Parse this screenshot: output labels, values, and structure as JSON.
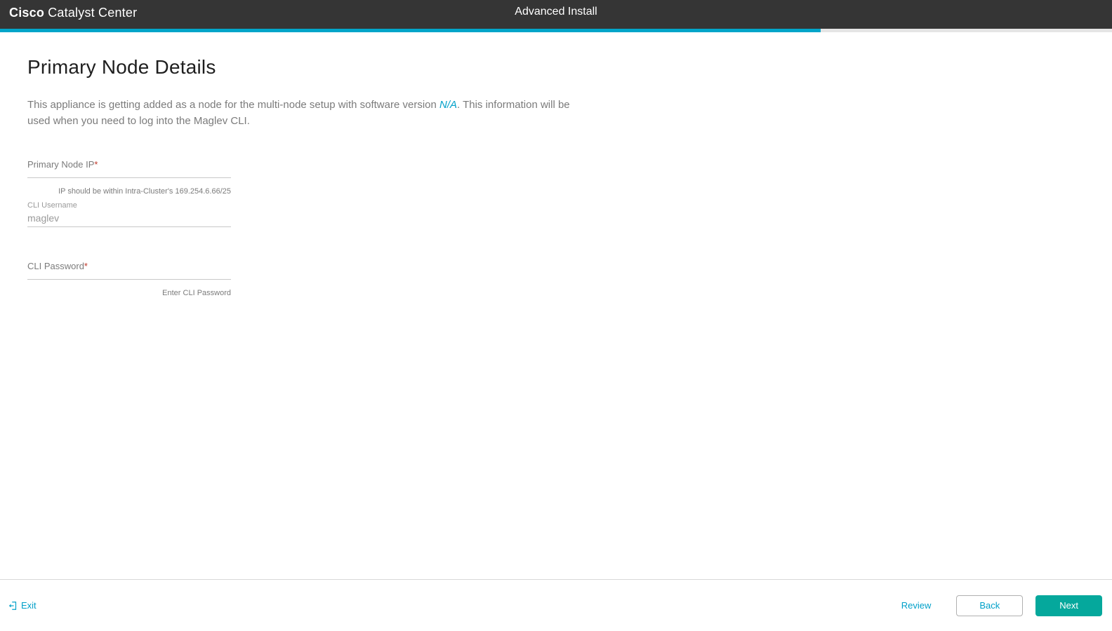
{
  "header": {
    "brand_strong": "Cisco",
    "brand_rest": " Catalyst Center",
    "title": "Advanced Install"
  },
  "progress": {
    "percent": 73.8
  },
  "page": {
    "title": "Primary Node Details",
    "desc_pre": "This appliance is getting added as a node for the multi-node setup with software version ",
    "desc_link": "N/A",
    "desc_post": ". This information will be used when you need to log into the Maglev CLI."
  },
  "form": {
    "ip_label": "Primary Node IP",
    "ip_helper": "IP should be within Intra-Cluster's 169.254.6.66/25",
    "username_label": "CLI Username",
    "username_value": "maglev",
    "password_label": "CLI Password",
    "password_helper": "Enter CLI Password"
  },
  "footer": {
    "exit": "Exit",
    "review": "Review",
    "back": "Back",
    "next": "Next"
  },
  "colors": {
    "accent": "#00a0c9",
    "primary_button": "#05a89c"
  }
}
